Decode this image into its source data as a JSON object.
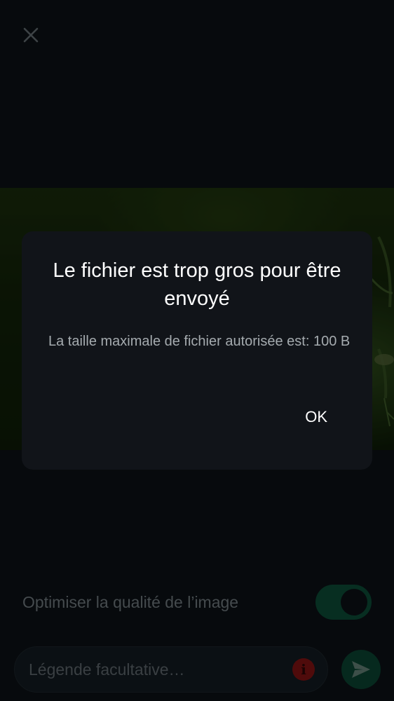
{
  "header": {
    "close_icon": "close-icon"
  },
  "media": {
    "kind": "photo-preview"
  },
  "options": {
    "quality_label": "Optimiser la qualité de l’image",
    "quality_enabled": true
  },
  "composer": {
    "caption_placeholder": "Légende facultative…",
    "info_icon": "info-icon",
    "send_icon": "send-icon"
  },
  "dialog": {
    "title": "Le fichier est trop gros pour être envoyé",
    "message": "La taille maximale de fichier autorisée est: 100 B",
    "ok_label": "OK"
  },
  "colors": {
    "background": "#0b1014",
    "dialog_background": "#111419",
    "accent_green": "#0b4733",
    "error_red": "#7a1212"
  }
}
